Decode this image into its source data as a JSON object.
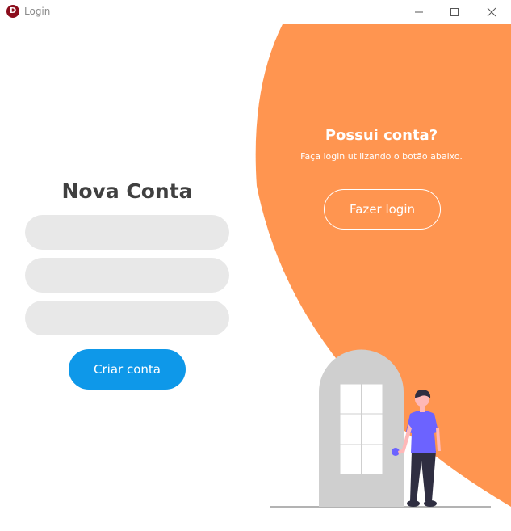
{
  "window": {
    "title": "Login",
    "app_icon_letter": "D",
    "controls": [
      "minimize",
      "maximize",
      "close"
    ]
  },
  "signup": {
    "title": "Nova Conta",
    "fields": [
      {
        "value": "",
        "placeholder": ""
      },
      {
        "value": "",
        "placeholder": ""
      },
      {
        "value": "",
        "placeholder": ""
      }
    ],
    "create_button": "Criar conta"
  },
  "login_panel": {
    "heading": "Possui conta?",
    "hint": "Faça login utilizando o botão abaixo.",
    "login_button": "Fazer login"
  },
  "colors": {
    "accent_orange": "#ff9550",
    "button_blue": "#0e98e9",
    "field_gray": "#e8e8e8",
    "title_text": "#404040",
    "person_shirt": "#6c63ff"
  },
  "icons": [
    "app-logo-icon",
    "minimize-icon",
    "maximize-icon",
    "close-icon"
  ]
}
